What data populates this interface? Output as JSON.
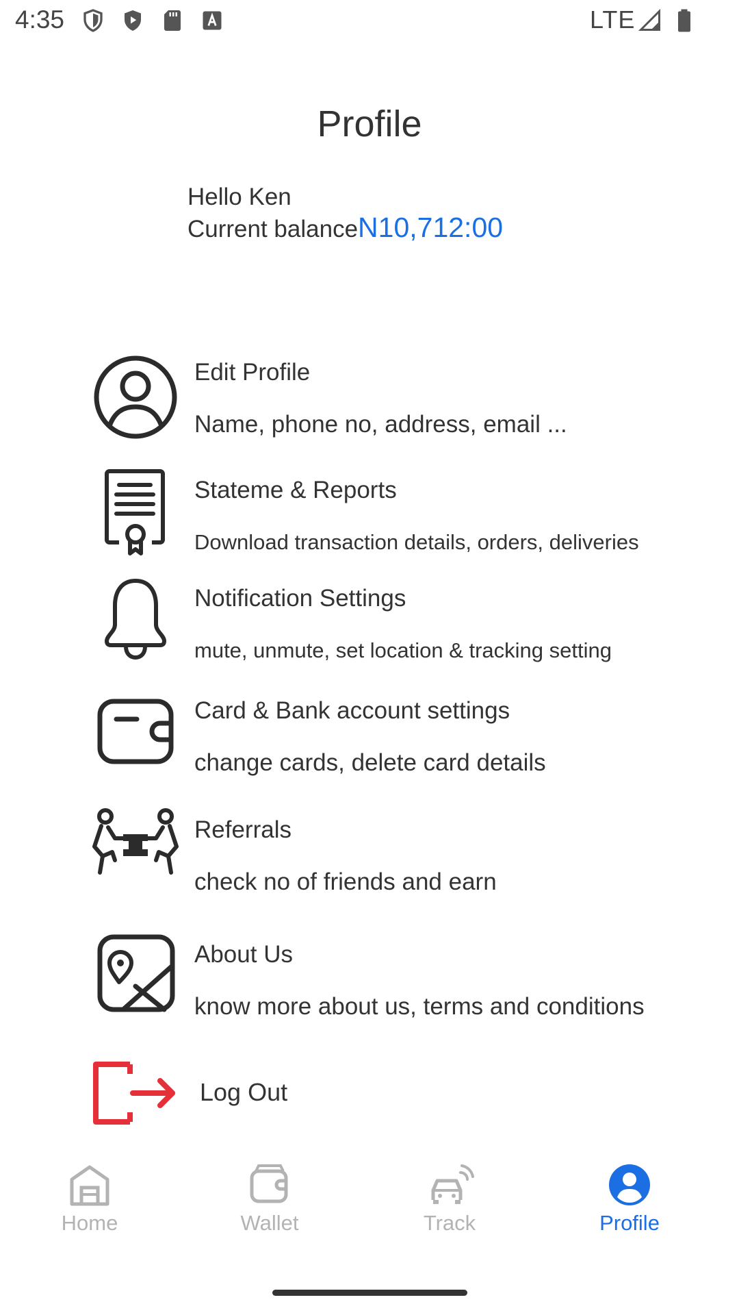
{
  "status_bar": {
    "time": "4:35",
    "network": "LTE",
    "icons": [
      "shield-icon",
      "play-protect-icon",
      "sd-card-icon",
      "keyboard-a-icon",
      "signal-icon",
      "battery-icon"
    ]
  },
  "header": {
    "title": "Profile",
    "greeting": "Hello Ken",
    "balance_label": "Current balance",
    "balance_amount": "N10,712:00"
  },
  "menu": {
    "items": [
      {
        "title": "Edit Profile",
        "subtitle": "Name, phone no, address, email ...",
        "icon": "user-circle-icon"
      },
      {
        "title": "Stateme & Reports",
        "subtitle": "Download transaction details, orders, deliveries",
        "icon": "certificate-icon"
      },
      {
        "title": "Notification Settings",
        "subtitle": "mute, unmute, set location & tracking setting",
        "icon": "bell-icon"
      },
      {
        "title": "Card & Bank account settings",
        "subtitle": "change cards, delete card details",
        "icon": "wallet-icon"
      },
      {
        "title": "Referrals",
        "subtitle": "check no of friends and earn",
        "icon": "people-handshake-icon"
      },
      {
        "title": "About Us",
        "subtitle": "know more about us, terms and conditions",
        "icon": "map-pin-icon"
      }
    ],
    "logout_label": "Log Out"
  },
  "bottom_nav": {
    "items": [
      {
        "label": "Home",
        "icon": "home-icon",
        "active": false
      },
      {
        "label": "Wallet",
        "icon": "wallet-icon",
        "active": false
      },
      {
        "label": "Track",
        "icon": "car-signal-icon",
        "active": false
      },
      {
        "label": "Profile",
        "icon": "profile-icon",
        "active": true
      }
    ]
  },
  "colors": {
    "accent": "#1b6fe3",
    "logout": "#e5303a",
    "text": "#333333",
    "inactive": "#b3b3b3"
  }
}
